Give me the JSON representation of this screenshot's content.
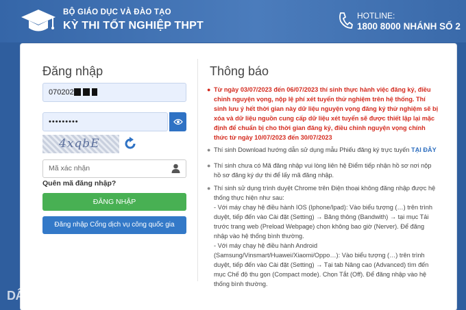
{
  "header": {
    "org_name": "BỘ GIÁO DỤC VÀ ĐÀO TẠO",
    "exam_name": "KỲ THI TỐT NGHIỆP THPT",
    "hotline_label": "HOTLINE:",
    "hotline_number": "1800 8000 NHÁNH SỐ 2"
  },
  "login": {
    "title": "Đăng nhập",
    "username_value": "070202",
    "password_value": "•••••••••",
    "captcha_text": "4xqbE",
    "code_placeholder": "Mã xác nhận",
    "forgot_label": "Quên mã đăng nhập?",
    "login_button": "ĐĂNG NHẬP",
    "portal_button": "Đăng nhập Cổng dịch vụ công quốc gia"
  },
  "notice": {
    "title": "Thông báo",
    "items": [
      {
        "text": "Từ ngày 03/07/2023 đến 06/07/2023 thí sinh thực hành việc đăng ký, điều chỉnh nguyện vọng, nộp lệ phí xét tuyển thử nghiệm trên hệ thống. Thí sinh lưu ý hết thời gian này dữ liệu nguyện vọng đăng ký thử nghiệm sẽ bị xóa và dữ liệu nguồn cung cấp dữ liệu xét tuyển sẽ được thiết lập lại mặc định để chuẩn bị cho thời gian đăng ký, điều chỉnh nguyện vọng chính thức từ ngày 10/07/2023 đến 30/07/2023"
      },
      {
        "text": "Thí sinh Download hướng dẫn sử dụng mẫu Phiếu đăng ký trực tuyến",
        "link": "TẠI ĐÂY"
      },
      {
        "text": "Thí sinh chưa có Mã đăng nhập vui lòng liên hệ Điểm tiếp nhận hồ sơ nơi nộp hồ sơ đăng ký dự thi để lấy mã đăng nhập."
      },
      {
        "text": "Thí sinh sử dụng trình duyệt Chrome trên Điện thoại không đăng nhập được hệ thống thực hiện như sau:"
      },
      {
        "text": " - Với máy chạy hệ điều hành IOS (Iphone/Ipad): Vào biểu tượng (…) trên trình duyệt, tiếp đến vào Cài đặt (Setting) → Băng thông (Bandwith) → tại mục Tải trước trang web (Preload Webpage) chọn không bao giờ (Nerver). Để đăng nhập vào hệ thống bình thường."
      },
      {
        "text": " - Với máy chạy hệ điều hành Android (Samsung/Vinsmart/Huawei/Xiaomi/Oppo…): Vào biểu tượng (…) trên trình duyệt, tiếp đến vào Cài đặt (Setting) → Tại tab Nâng cao (Advanced) tìm đến mục Chế độ thu gọn (Compact mode). Chọn Tắt (Off). Để đăng nhập vào hệ thống bình thường."
      }
    ]
  },
  "watermark": "DÂN TRÍ",
  "colors": {
    "header": "#3566a8",
    "green": "#48b053",
    "blue": "#3379c8",
    "red": "#d42a1e"
  }
}
